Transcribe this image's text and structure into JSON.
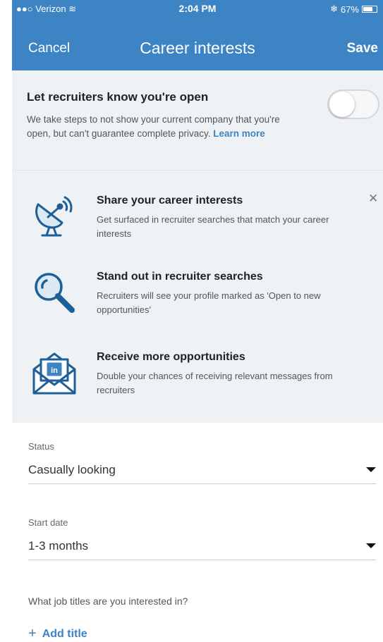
{
  "status_bar": {
    "carrier": "Verizon",
    "time": "2:04 PM",
    "battery": "67%"
  },
  "nav": {
    "cancel": "Cancel",
    "title": "Career interests",
    "save": "Save"
  },
  "recruiter": {
    "title": "Let recruiters know you're open",
    "description": "We take steps to not show your current company that you're open, but can't guarantee complete privacy.",
    "learn_more": "Learn more",
    "toggle_on": false
  },
  "features": [
    {
      "icon": "satellite-dish-icon",
      "title": "Share your career interests",
      "description": "Get surfaced in recruiter searches that match your career interests"
    },
    {
      "icon": "magnifier-icon",
      "title": "Stand out in recruiter searches",
      "description": "Recruiters will see your profile marked as 'Open to new opportunities'"
    },
    {
      "icon": "envelope-in-icon",
      "title": "Receive more opportunities",
      "description": "Double your chances of receiving relevant messages from recruiters"
    }
  ],
  "form": {
    "status_label": "Status",
    "status_value": "Casually looking",
    "start_date_label": "Start date",
    "start_date_value": "1-3 months",
    "job_titles_question": "What job titles are you interested in?",
    "add_title": "Add title"
  },
  "colors": {
    "accent": "#3c84c4",
    "panel_bg": "#eef2f5"
  }
}
